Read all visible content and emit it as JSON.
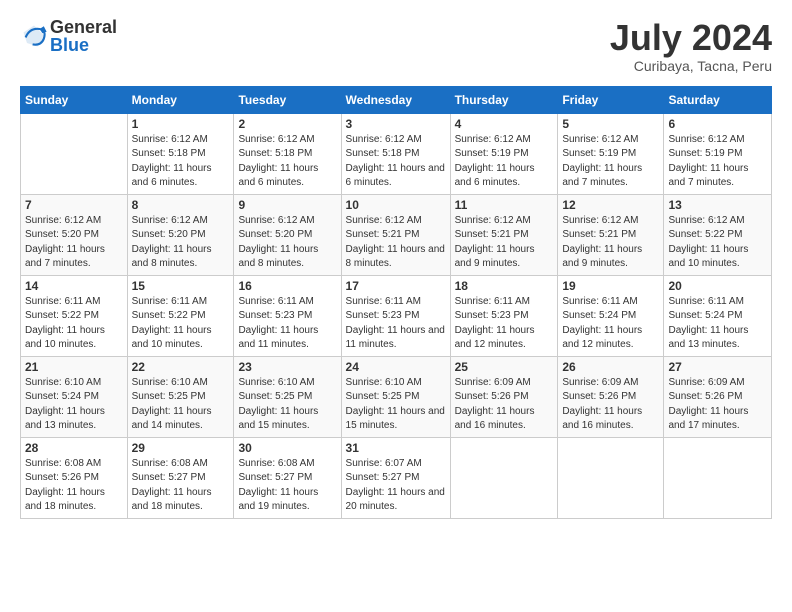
{
  "logo": {
    "general": "General",
    "blue": "Blue"
  },
  "title": "July 2024",
  "location": "Curibaya, Tacna, Peru",
  "weekdays": [
    "Sunday",
    "Monday",
    "Tuesday",
    "Wednesday",
    "Thursday",
    "Friday",
    "Saturday"
  ],
  "weeks": [
    [
      {
        "day": "",
        "sunrise": "",
        "sunset": "",
        "daylight": ""
      },
      {
        "day": "1",
        "sunrise": "Sunrise: 6:12 AM",
        "sunset": "Sunset: 5:18 PM",
        "daylight": "Daylight: 11 hours and 6 minutes."
      },
      {
        "day": "2",
        "sunrise": "Sunrise: 6:12 AM",
        "sunset": "Sunset: 5:18 PM",
        "daylight": "Daylight: 11 hours and 6 minutes."
      },
      {
        "day": "3",
        "sunrise": "Sunrise: 6:12 AM",
        "sunset": "Sunset: 5:18 PM",
        "daylight": "Daylight: 11 hours and 6 minutes."
      },
      {
        "day": "4",
        "sunrise": "Sunrise: 6:12 AM",
        "sunset": "Sunset: 5:19 PM",
        "daylight": "Daylight: 11 hours and 6 minutes."
      },
      {
        "day": "5",
        "sunrise": "Sunrise: 6:12 AM",
        "sunset": "Sunset: 5:19 PM",
        "daylight": "Daylight: 11 hours and 7 minutes."
      },
      {
        "day": "6",
        "sunrise": "Sunrise: 6:12 AM",
        "sunset": "Sunset: 5:19 PM",
        "daylight": "Daylight: 11 hours and 7 minutes."
      }
    ],
    [
      {
        "day": "7",
        "sunrise": "Sunrise: 6:12 AM",
        "sunset": "Sunset: 5:20 PM",
        "daylight": "Daylight: 11 hours and 7 minutes."
      },
      {
        "day": "8",
        "sunrise": "Sunrise: 6:12 AM",
        "sunset": "Sunset: 5:20 PM",
        "daylight": "Daylight: 11 hours and 8 minutes."
      },
      {
        "day": "9",
        "sunrise": "Sunrise: 6:12 AM",
        "sunset": "Sunset: 5:20 PM",
        "daylight": "Daylight: 11 hours and 8 minutes."
      },
      {
        "day": "10",
        "sunrise": "Sunrise: 6:12 AM",
        "sunset": "Sunset: 5:21 PM",
        "daylight": "Daylight: 11 hours and 8 minutes."
      },
      {
        "day": "11",
        "sunrise": "Sunrise: 6:12 AM",
        "sunset": "Sunset: 5:21 PM",
        "daylight": "Daylight: 11 hours and 9 minutes."
      },
      {
        "day": "12",
        "sunrise": "Sunrise: 6:12 AM",
        "sunset": "Sunset: 5:21 PM",
        "daylight": "Daylight: 11 hours and 9 minutes."
      },
      {
        "day": "13",
        "sunrise": "Sunrise: 6:12 AM",
        "sunset": "Sunset: 5:22 PM",
        "daylight": "Daylight: 11 hours and 10 minutes."
      }
    ],
    [
      {
        "day": "14",
        "sunrise": "Sunrise: 6:11 AM",
        "sunset": "Sunset: 5:22 PM",
        "daylight": "Daylight: 11 hours and 10 minutes."
      },
      {
        "day": "15",
        "sunrise": "Sunrise: 6:11 AM",
        "sunset": "Sunset: 5:22 PM",
        "daylight": "Daylight: 11 hours and 10 minutes."
      },
      {
        "day": "16",
        "sunrise": "Sunrise: 6:11 AM",
        "sunset": "Sunset: 5:23 PM",
        "daylight": "Daylight: 11 hours and 11 minutes."
      },
      {
        "day": "17",
        "sunrise": "Sunrise: 6:11 AM",
        "sunset": "Sunset: 5:23 PM",
        "daylight": "Daylight: 11 hours and 11 minutes."
      },
      {
        "day": "18",
        "sunrise": "Sunrise: 6:11 AM",
        "sunset": "Sunset: 5:23 PM",
        "daylight": "Daylight: 11 hours and 12 minutes."
      },
      {
        "day": "19",
        "sunrise": "Sunrise: 6:11 AM",
        "sunset": "Sunset: 5:24 PM",
        "daylight": "Daylight: 11 hours and 12 minutes."
      },
      {
        "day": "20",
        "sunrise": "Sunrise: 6:11 AM",
        "sunset": "Sunset: 5:24 PM",
        "daylight": "Daylight: 11 hours and 13 minutes."
      }
    ],
    [
      {
        "day": "21",
        "sunrise": "Sunrise: 6:10 AM",
        "sunset": "Sunset: 5:24 PM",
        "daylight": "Daylight: 11 hours and 13 minutes."
      },
      {
        "day": "22",
        "sunrise": "Sunrise: 6:10 AM",
        "sunset": "Sunset: 5:25 PM",
        "daylight": "Daylight: 11 hours and 14 minutes."
      },
      {
        "day": "23",
        "sunrise": "Sunrise: 6:10 AM",
        "sunset": "Sunset: 5:25 PM",
        "daylight": "Daylight: 11 hours and 15 minutes."
      },
      {
        "day": "24",
        "sunrise": "Sunrise: 6:10 AM",
        "sunset": "Sunset: 5:25 PM",
        "daylight": "Daylight: 11 hours and 15 minutes."
      },
      {
        "day": "25",
        "sunrise": "Sunrise: 6:09 AM",
        "sunset": "Sunset: 5:26 PM",
        "daylight": "Daylight: 11 hours and 16 minutes."
      },
      {
        "day": "26",
        "sunrise": "Sunrise: 6:09 AM",
        "sunset": "Sunset: 5:26 PM",
        "daylight": "Daylight: 11 hours and 16 minutes."
      },
      {
        "day": "27",
        "sunrise": "Sunrise: 6:09 AM",
        "sunset": "Sunset: 5:26 PM",
        "daylight": "Daylight: 11 hours and 17 minutes."
      }
    ],
    [
      {
        "day": "28",
        "sunrise": "Sunrise: 6:08 AM",
        "sunset": "Sunset: 5:26 PM",
        "daylight": "Daylight: 11 hours and 18 minutes."
      },
      {
        "day": "29",
        "sunrise": "Sunrise: 6:08 AM",
        "sunset": "Sunset: 5:27 PM",
        "daylight": "Daylight: 11 hours and 18 minutes."
      },
      {
        "day": "30",
        "sunrise": "Sunrise: 6:08 AM",
        "sunset": "Sunset: 5:27 PM",
        "daylight": "Daylight: 11 hours and 19 minutes."
      },
      {
        "day": "31",
        "sunrise": "Sunrise: 6:07 AM",
        "sunset": "Sunset: 5:27 PM",
        "daylight": "Daylight: 11 hours and 20 minutes."
      },
      {
        "day": "",
        "sunrise": "",
        "sunset": "",
        "daylight": ""
      },
      {
        "day": "",
        "sunrise": "",
        "sunset": "",
        "daylight": ""
      },
      {
        "day": "",
        "sunrise": "",
        "sunset": "",
        "daylight": ""
      }
    ]
  ]
}
